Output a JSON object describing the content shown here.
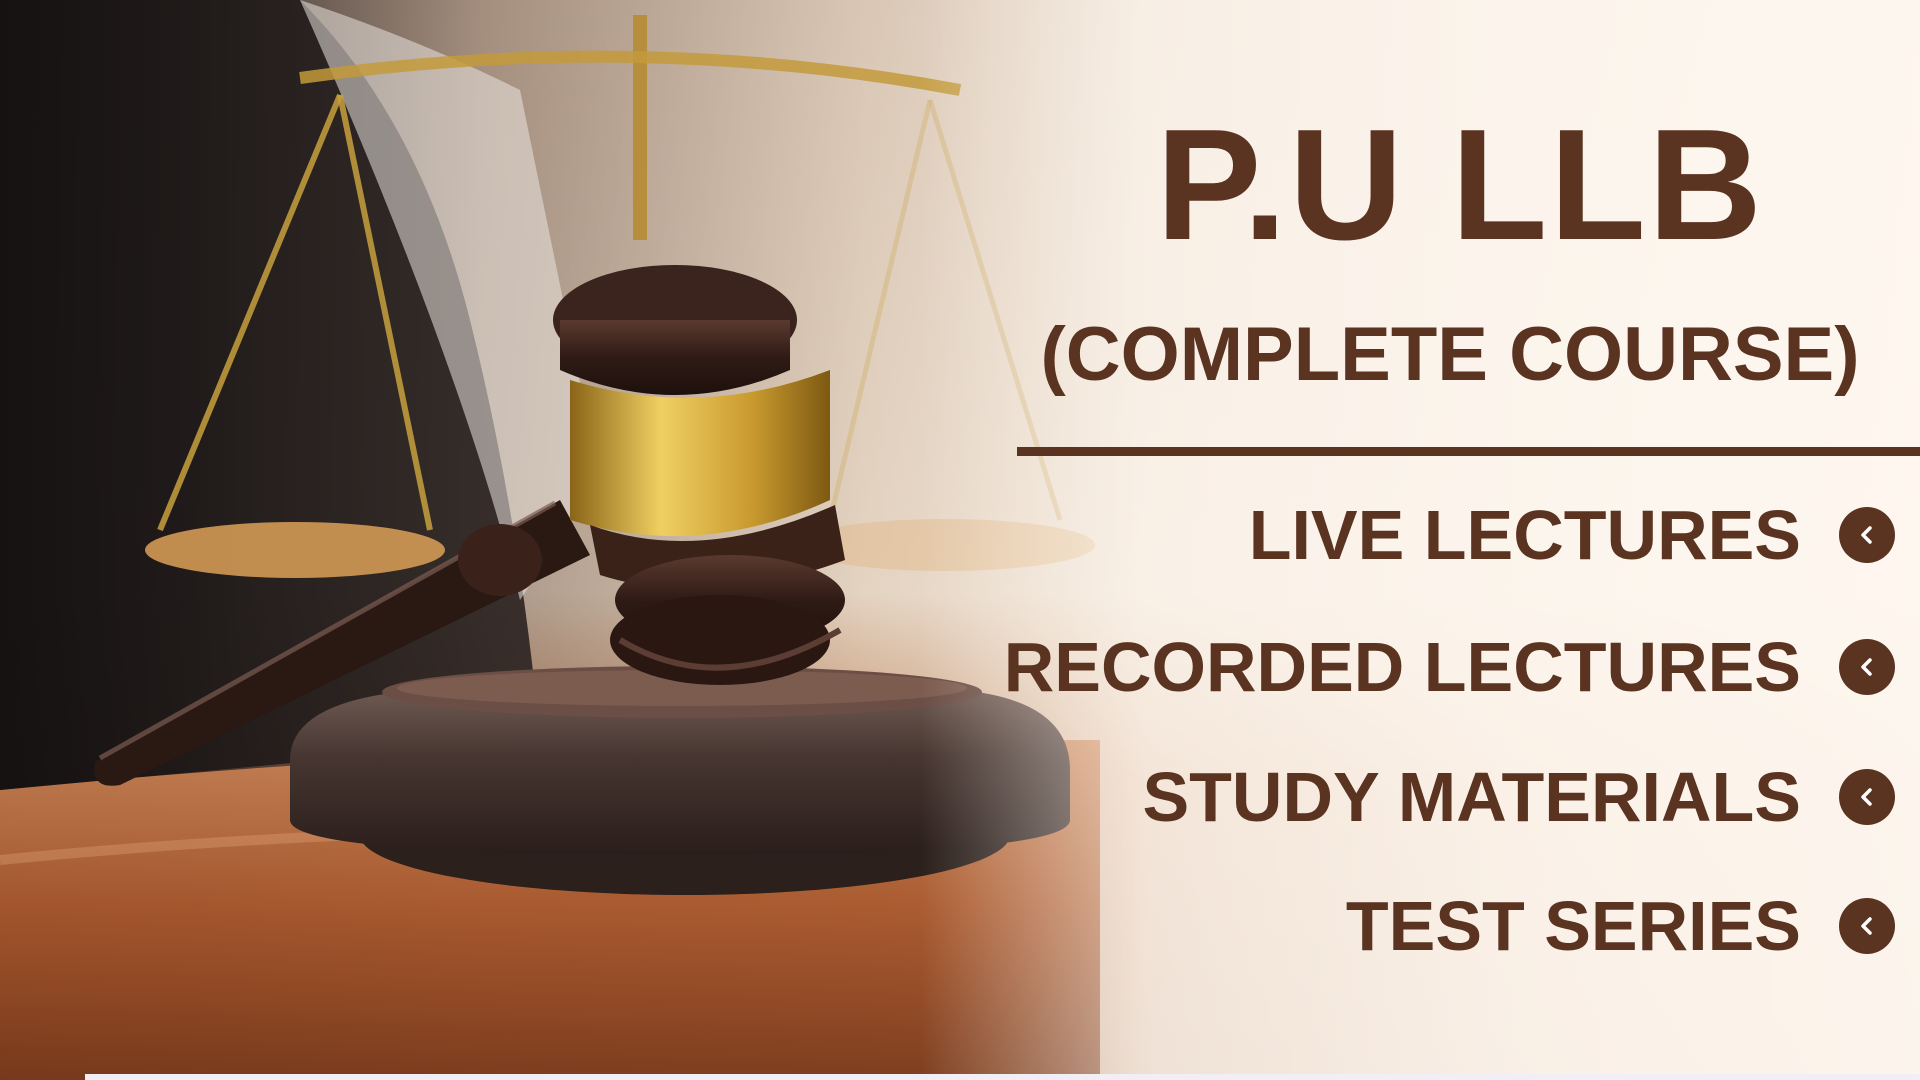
{
  "title": "P.U LLB",
  "subtitle": "(COMPLETE COURSE)",
  "features": [
    {
      "label": "LIVE LECTURES",
      "icon": "chevron-left-icon"
    },
    {
      "label": "RECORDED LECTURES",
      "icon": "chevron-left-icon"
    },
    {
      "label": "STUDY MATERIALS",
      "icon": "chevron-left-icon"
    },
    {
      "label": "TEST SERIES",
      "icon": "chevron-left-icon"
    }
  ],
  "colors": {
    "text": "#5a3321",
    "gavel_wood": "#3e241c",
    "gavel_band": "#c9a23a",
    "desk": "#b46a3c"
  }
}
